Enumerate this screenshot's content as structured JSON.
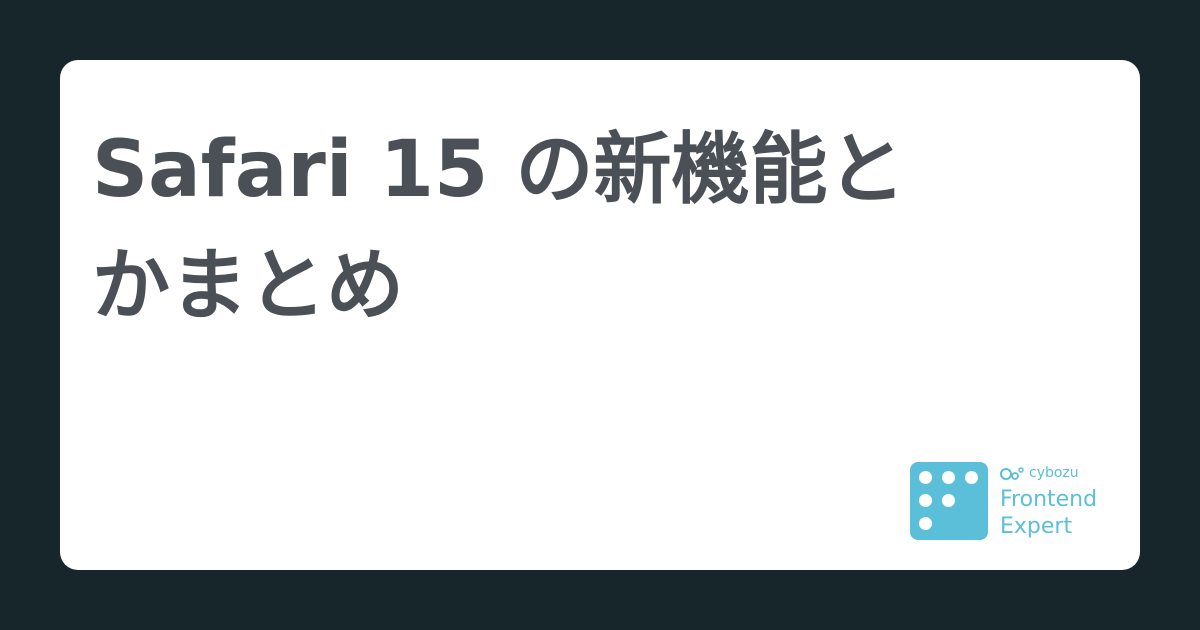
{
  "title": {
    "line1": "Safari 15 の新機能と",
    "line2": "かまとめ"
  },
  "logo": {
    "brand": "cybozu",
    "product_line1": "Frontend",
    "product_line2": "Expert",
    "mark_icon": "dot-grid-icon",
    "brand_icon": "cybozu-mark-icon"
  },
  "colors": {
    "background": "#17262b",
    "card": "#ffffff",
    "title_text": "#4a5055",
    "accent": "#5bbfd9"
  }
}
